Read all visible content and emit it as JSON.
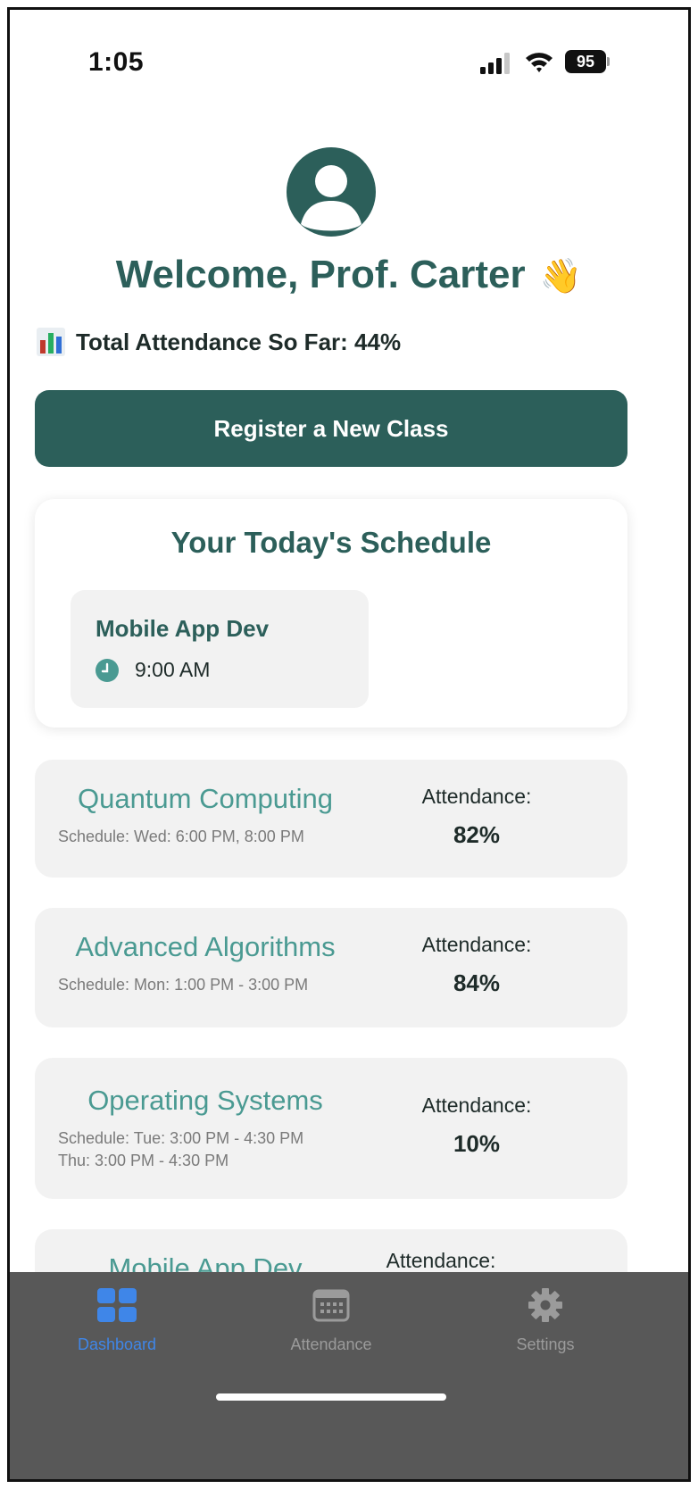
{
  "status_bar": {
    "time": "1:05",
    "battery": "95"
  },
  "header": {
    "welcome": "Welcome, Prof. Carter",
    "wave_emoji": "👋",
    "total_attendance": "Total Attendance So Far: 44%"
  },
  "register_button": "Register a New Class",
  "schedule": {
    "title": "Your Today's Schedule",
    "items": [
      {
        "name": "Mobile App Dev",
        "time": "9:00 AM"
      }
    ]
  },
  "classes": [
    {
      "name": "Quantum Computing",
      "schedule": [
        "Schedule: Wed: 6:00 PM, 8:00 PM"
      ],
      "attendance_label": "Attendance:",
      "attendance": "82%"
    },
    {
      "name": "Advanced Algorithms",
      "schedule": [
        "Schedule: Mon: 1:00 PM - 3:00 PM"
      ],
      "attendance_label": "Attendance:",
      "attendance": "84%"
    },
    {
      "name": "Operating Systems",
      "schedule": [
        "Schedule: Tue: 3:00 PM - 4:30 PM",
        "Thu: 3:00 PM - 4:30 PM"
      ],
      "attendance_label": "Attendance:",
      "attendance": "10%"
    },
    {
      "name": "Mobile App Dev",
      "schedule": [],
      "attendance_label": "Attendance:",
      "attendance": ""
    }
  ],
  "tabs": [
    {
      "label": "Dashboard",
      "icon": "dashboard-grid-icon",
      "active": true
    },
    {
      "label": "Attendance",
      "icon": "calendar-icon",
      "active": false
    },
    {
      "label": "Settings",
      "icon": "gear-icon",
      "active": false
    }
  ],
  "colors": {
    "primary": "#2c5f5a",
    "class_name": "#4a9a92",
    "active_tab": "#3f86e8",
    "tabbar": "#585858"
  }
}
